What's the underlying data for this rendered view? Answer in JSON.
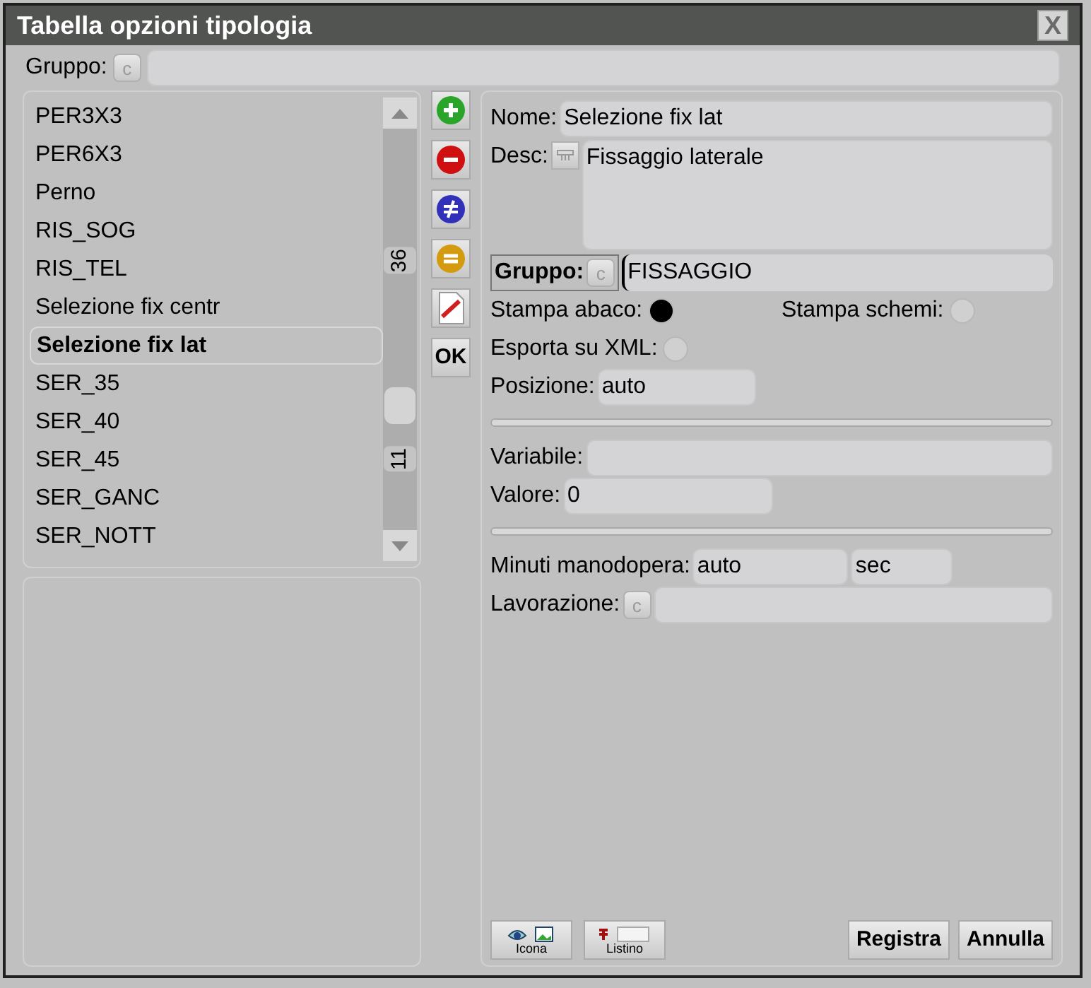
{
  "window": {
    "title": "Tabella opzioni tipologia",
    "close": "X"
  },
  "group_filter": {
    "label": "Gruppo:",
    "button": "c"
  },
  "list": {
    "items": [
      {
        "label": "PER3X3",
        "selected": false
      },
      {
        "label": "PER6X3",
        "selected": false
      },
      {
        "label": "Perno",
        "selected": false
      },
      {
        "label": "RIS_SOG",
        "selected": false
      },
      {
        "label": "RIS_TEL",
        "selected": false
      },
      {
        "label": "Selezione fix centr",
        "selected": false
      },
      {
        "label": "Selezione fix lat",
        "selected": true
      },
      {
        "label": "SER_35",
        "selected": false
      },
      {
        "label": "SER_40",
        "selected": false
      },
      {
        "label": "SER_45",
        "selected": false
      },
      {
        "label": "SER_GANC",
        "selected": false
      },
      {
        "label": "SER_NOTT",
        "selected": false
      }
    ],
    "scroll_above": "36",
    "scroll_below": "11"
  },
  "toolbar": [
    {
      "kind": "add"
    },
    {
      "kind": "remove"
    },
    {
      "kind": "differ"
    },
    {
      "kind": "equal"
    },
    {
      "kind": "alias"
    },
    {
      "kind": "ok",
      "label": "OK"
    }
  ],
  "form": {
    "nome": {
      "label": "Nome:",
      "value": "Selezione fix lat"
    },
    "desc": {
      "label": "Desc:",
      "value": "Fissaggio laterale"
    },
    "gruppo": {
      "label": "Gruppo:",
      "button": "c",
      "value": "FISSAGGIO"
    },
    "stampa_abaco": {
      "label": "Stampa abaco:",
      "checked": true
    },
    "stampa_schemi": {
      "label": "Stampa schemi:",
      "checked": false
    },
    "esporta_xml": {
      "label": "Esporta su XML:",
      "checked": false
    },
    "posizione": {
      "label": "Posizione:",
      "value": "auto"
    },
    "variabile": {
      "label": "Variabile:"
    },
    "valore": {
      "label": "Valore:",
      "value": "0"
    },
    "minuti": {
      "label": "Minuti manodopera:",
      "value": "auto",
      "unit": "sec"
    },
    "lavorazione": {
      "label": "Lavorazione:",
      "button": "c"
    }
  },
  "bottom_tools": [
    {
      "kind": "icon",
      "label": "Icona"
    },
    {
      "kind": "price",
      "label": "Listino"
    }
  ],
  "buttons": [
    "Registra",
    "Annulla"
  ]
}
